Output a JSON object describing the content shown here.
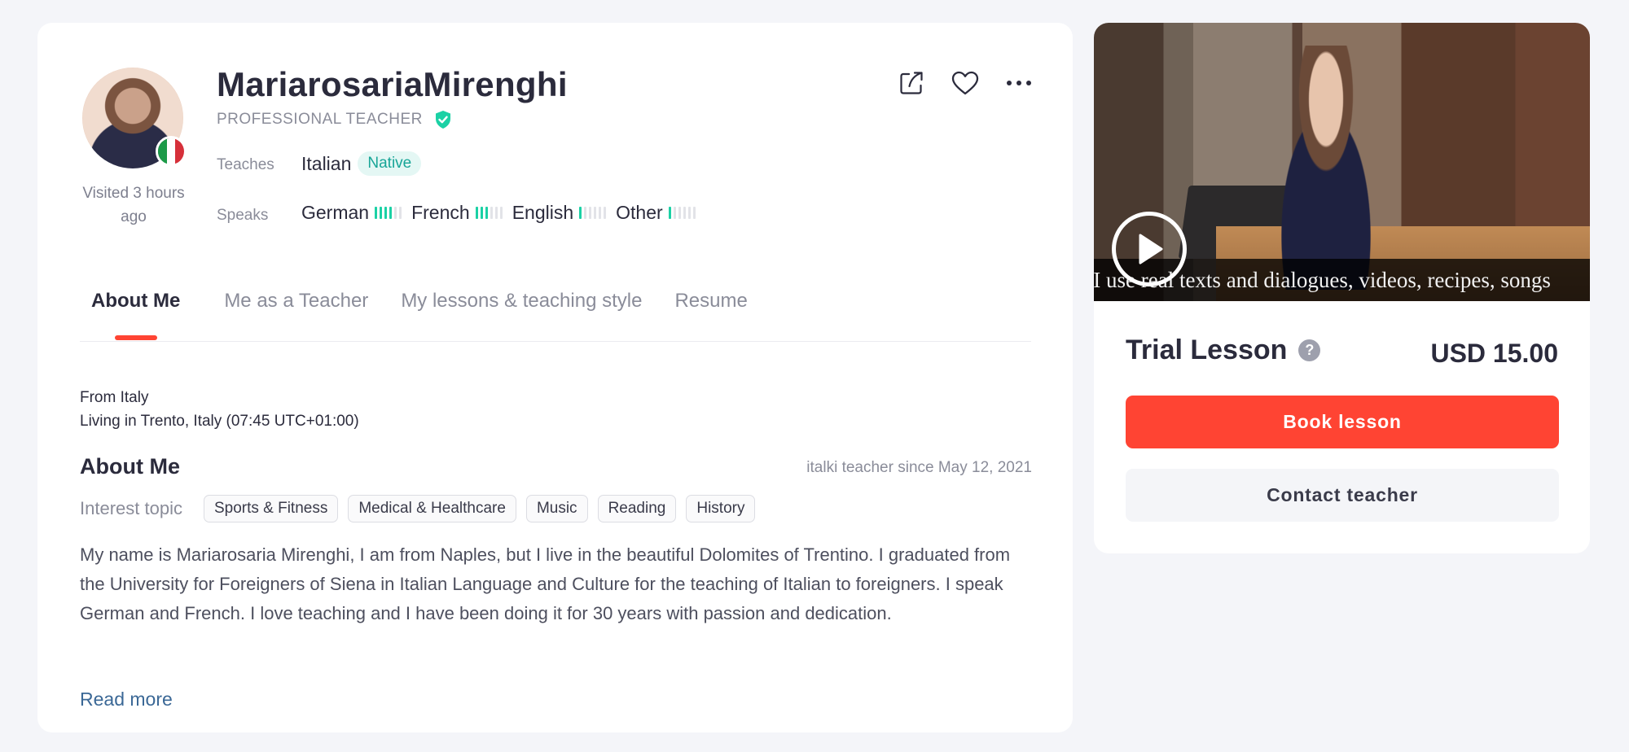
{
  "colors": {
    "accent": "#ff4433",
    "native_badge": "#17a597",
    "level_bar_on": "#1bd1a5",
    "link": "#3b6896"
  },
  "profile": {
    "name": "MariarosariaMirenghi",
    "role": "PROFESSIONAL TEACHER",
    "visited": "Visited 3 hours ago",
    "country_flag": "italy-flag-icon",
    "teaches_label": "Teaches",
    "teaches_language": "Italian",
    "native_badge": "Native",
    "speaks_label": "Speaks",
    "speaks": [
      {
        "language": "German",
        "level": 4
      },
      {
        "language": "French",
        "level": 3
      },
      {
        "language": "English",
        "level": 1
      },
      {
        "language": "Other",
        "level": 1
      }
    ],
    "max_level": 6,
    "actions": [
      "share-icon",
      "heart-icon",
      "more-icon"
    ]
  },
  "tabs": [
    {
      "label": "About Me",
      "active": true
    },
    {
      "label": "Me as a Teacher",
      "active": false
    },
    {
      "label": "My lessons & teaching style",
      "active": false
    },
    {
      "label": "Resume",
      "active": false
    }
  ],
  "about": {
    "from": "From Italy",
    "living": "Living in Trento, Italy (07:45 UTC+01:00)",
    "title": "About Me",
    "since": "italki teacher since May 12, 2021",
    "interest_label": "Interest topic",
    "topics": [
      "Sports & Fitness",
      "Medical & Healthcare",
      "Music",
      "Reading",
      "History"
    ],
    "text": "My name is Mariarosaria Mirenghi, I am from Naples, but I live in the beautiful Dolomites of Trentino. I graduated from the University for Foreigners of Siena in Italian Language and Culture for the teaching of Italian to foreigners. I speak German and French. I love teaching and I have been doing it for 30 years with passion and dedication.",
    "read_more": "Read more"
  },
  "lesson": {
    "video_subtitle": "s I use real texts and dialogues, videos, recipes, songs",
    "trial_title": "Trial Lesson",
    "price": "USD 15.00",
    "book_label": "Book lesson",
    "contact_label": "Contact teacher"
  }
}
